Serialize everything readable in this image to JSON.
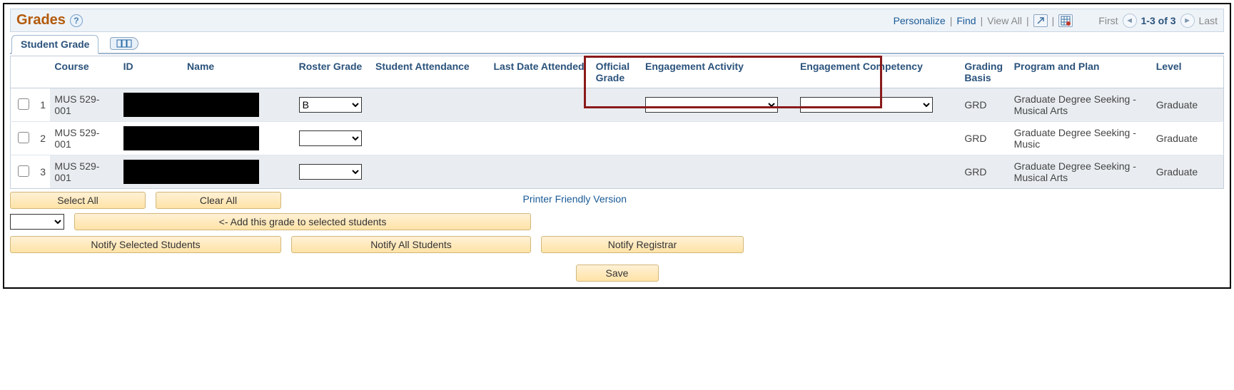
{
  "header": {
    "title": "Grades",
    "personalize": "Personalize",
    "find": "Find",
    "viewAll": "View All",
    "first": "First",
    "range": "1-3 of 3",
    "last": "Last"
  },
  "tab": {
    "label": "Student Grade"
  },
  "table": {
    "headers": {
      "course": "Course",
      "id": "ID",
      "name": "Name",
      "rosterGrade": "Roster Grade",
      "attendance": "Student Attendance",
      "lastDate": "Last Date Attended",
      "official": "Official Grade",
      "engActivity": "Engagement Activity",
      "engCompetency": "Engagement Competency",
      "basis": "Grading Basis",
      "plan": "Program and Plan",
      "level": "Level"
    },
    "rows": [
      {
        "num": "1",
        "course": "MUS 529-001",
        "gradeValue": "B",
        "basis": "GRD",
        "plan": "Graduate Degree Seeking - Musical Arts",
        "level": "Graduate",
        "showEngSelects": true
      },
      {
        "num": "2",
        "course": "MUS 529-001",
        "gradeValue": "",
        "basis": "GRD",
        "plan": "Graduate Degree Seeking - Music",
        "level": "Graduate",
        "showEngSelects": false
      },
      {
        "num": "3",
        "course": "MUS 529-001",
        "gradeValue": "",
        "basis": "GRD",
        "plan": "Graduate Degree Seeking - Musical Arts",
        "level": "Graduate",
        "showEngSelects": false
      }
    ]
  },
  "actions": {
    "selectAll": "Select All",
    "clearAll": "Clear All",
    "printer": "Printer Friendly Version",
    "addGrade": "<- Add this grade to selected students",
    "notifySelected": "Notify Selected Students",
    "notifyAll": "Notify All Students",
    "notifyRegistrar": "Notify Registrar",
    "save": "Save"
  }
}
